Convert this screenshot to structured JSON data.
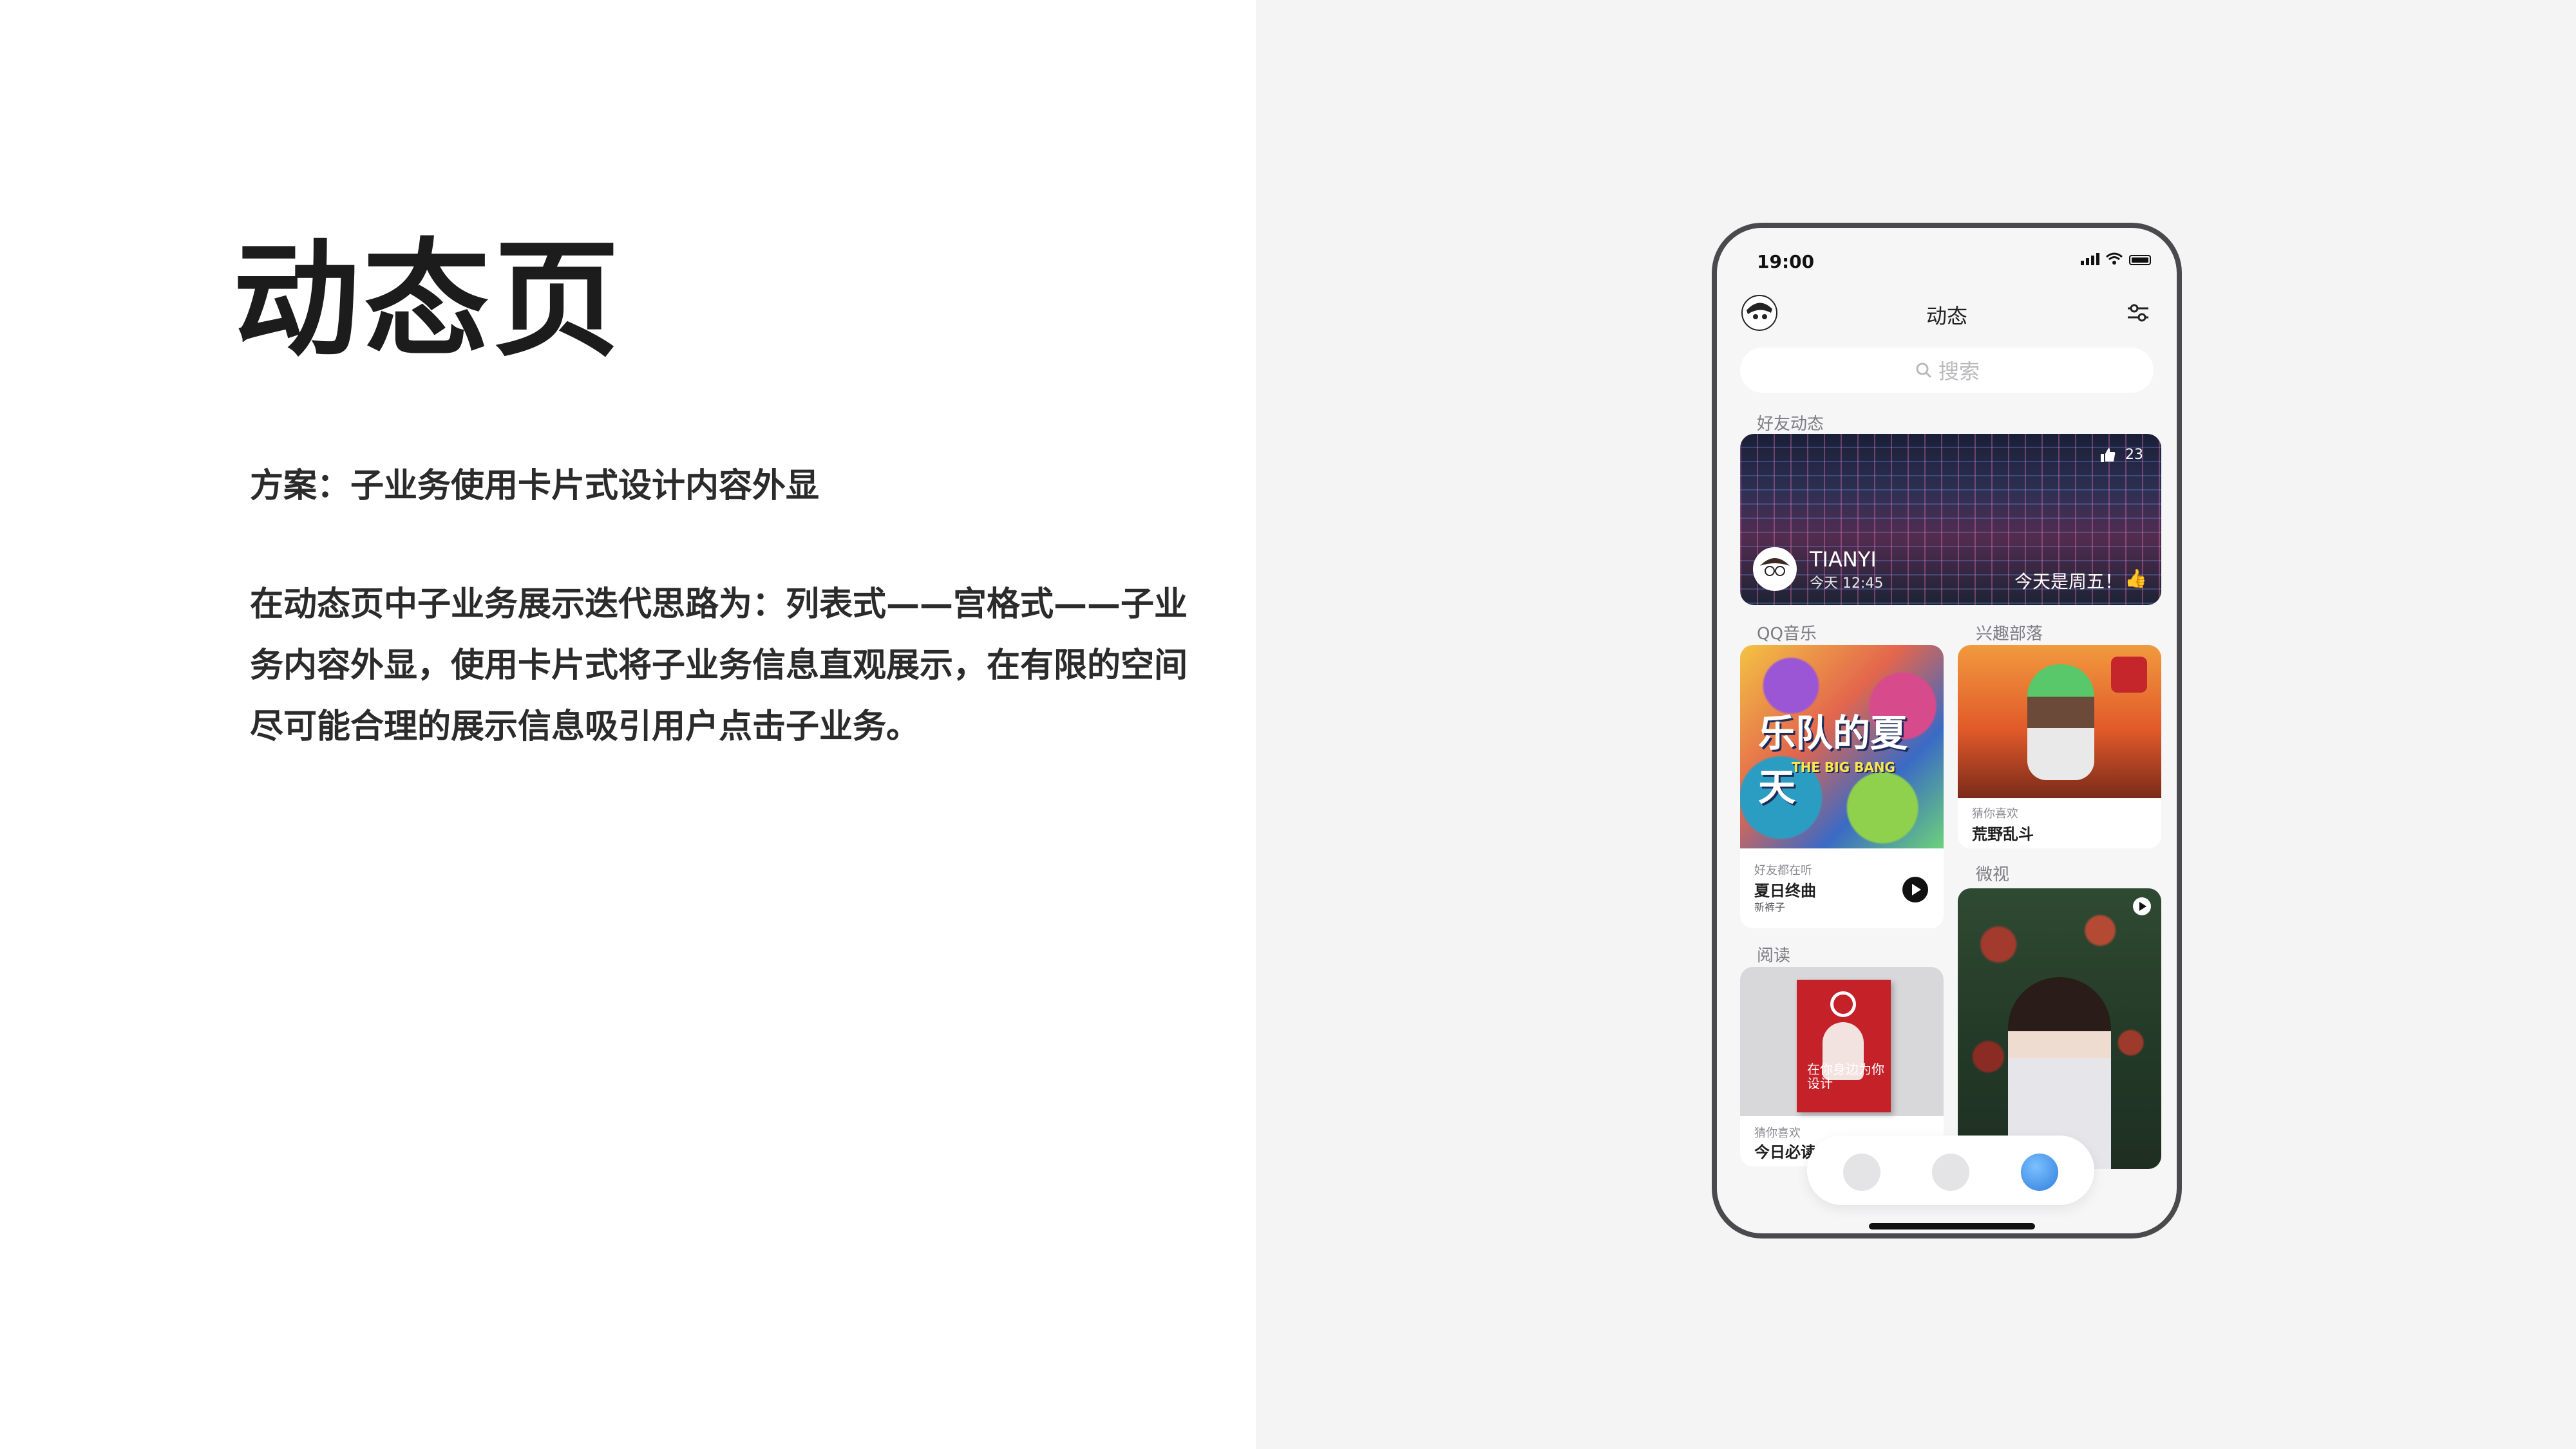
{
  "slide": {
    "title": "动态页",
    "subtitle": "方案：子业务使用卡片式设计内容外显",
    "description_lines": [
      "在动态页中子业务展示迭代思路为：列表式——宫格式——子业",
      "务内容外显，使用卡片式将子业务信息直观展示，在有限的空间",
      "尽可能合理的展示信息吸引用户点击子业务。"
    ]
  },
  "phone": {
    "status_bar": {
      "time": "19:00"
    },
    "nav": {
      "title": "动态"
    },
    "search": {
      "placeholder": "搜索"
    },
    "friends_section": {
      "label": "好友动态",
      "card": {
        "user_name": "TIANYI",
        "time": "今天 12:45",
        "message": "今天是周五！",
        "emoji": "👍",
        "like_count": "23"
      }
    },
    "music_section": {
      "label": "QQ音乐",
      "art_title": "乐队的夏天",
      "art_subtitle": "THE BIG BANG",
      "caption": "好友都在听",
      "song": "夏日终曲",
      "artist": "新裤子"
    },
    "game_section": {
      "label": "兴趣部落",
      "caption": "猜你喜欢",
      "title": "荒野乱斗"
    },
    "video_section": {
      "label": "微视"
    },
    "reading_section": {
      "label": "阅读",
      "book_title": "在你身边为你设计",
      "caption": "猜你喜欢",
      "title": "今日必读"
    },
    "tab_bar": {
      "tabs": [
        "message",
        "contacts",
        "discover"
      ]
    }
  },
  "colors": {
    "right_background": "#f4f4f5",
    "phone_frame": "#4a4a4c",
    "accent_blue": "#3a8ee6"
  }
}
